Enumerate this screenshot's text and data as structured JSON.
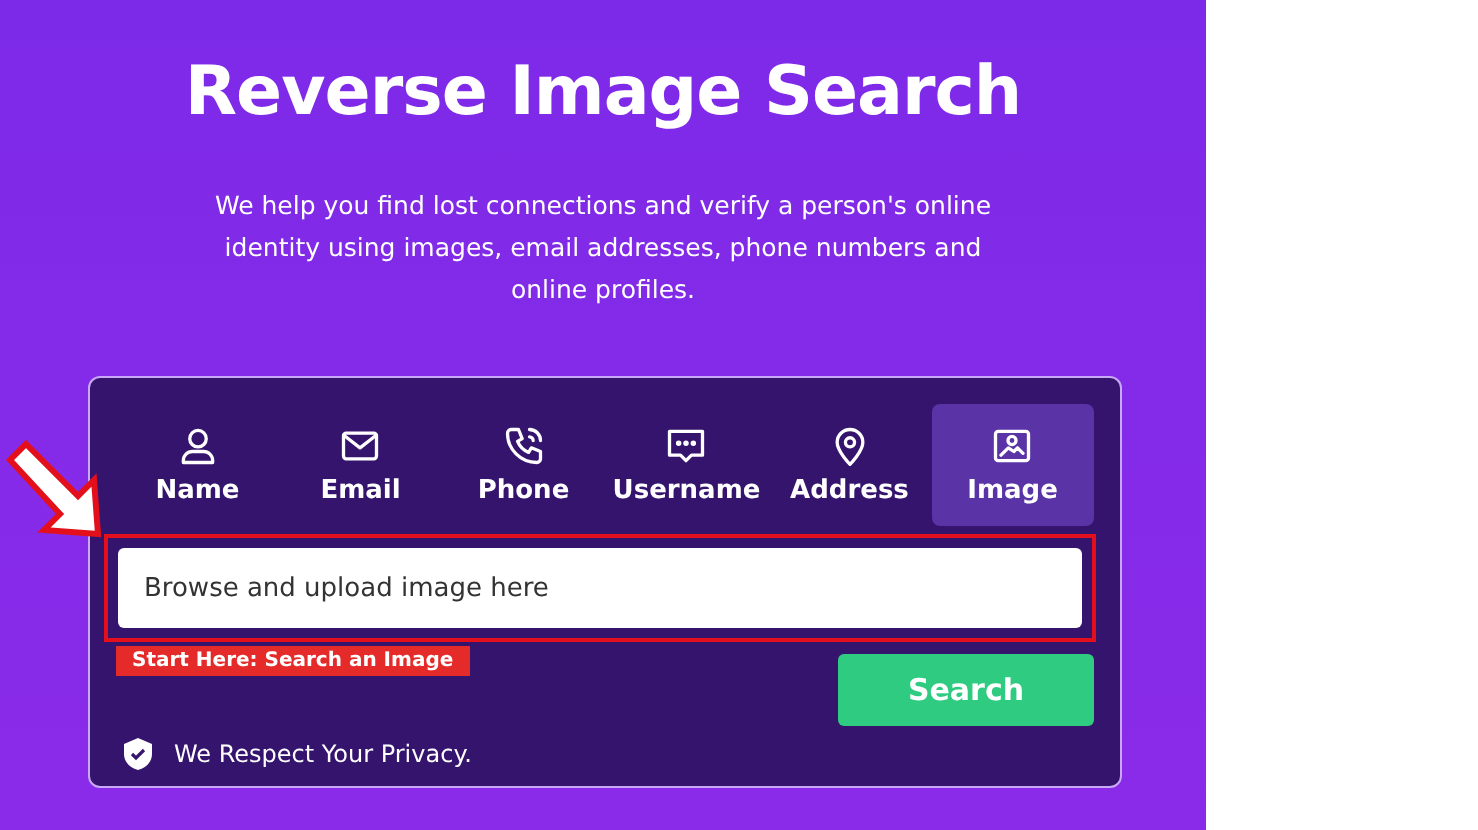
{
  "title": "Reverse Image Search",
  "intro": "We help you find lost connections and verify a person's online identity using images, email addresses, phone numbers and online profiles.",
  "tabs": [
    {
      "label": "Name",
      "selected": false
    },
    {
      "label": "Email",
      "selected": false
    },
    {
      "label": "Phone",
      "selected": false
    },
    {
      "label": "Username",
      "selected": false
    },
    {
      "label": "Address",
      "selected": false
    },
    {
      "label": "Image",
      "selected": true
    }
  ],
  "search": {
    "placeholder": "Browse and upload image here",
    "hint": "Start Here: Search an Image",
    "button": "Search"
  },
  "privacy": "We Respect Your Privacy."
}
